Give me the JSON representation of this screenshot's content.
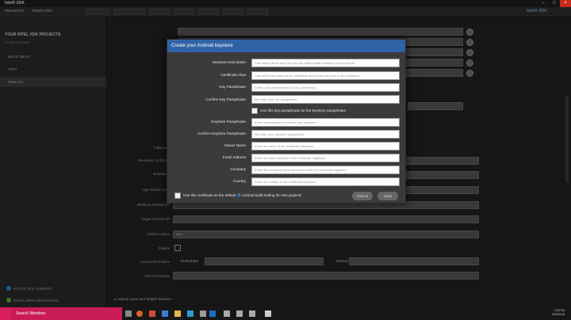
{
  "window": {
    "title": "Intel® XDK"
  },
  "navbar": {
    "tabs": [
      "PROJECTS",
      "TEMPLATES"
    ],
    "brand": "Intel® XDK"
  },
  "sidebar": {
    "heading": "YOUR INTEL XDK PROJECTS",
    "sub": "CLOSE   MANAGE",
    "items": [
      "BUILD IDEAS",
      "TEST",
      "PUBLISH"
    ],
    "bottom_items": [
      "INTEL® XDK SAMPLES",
      "DEVELOPER RESOURCES"
    ]
  },
  "main": {
    "launch_label": "Launch Icons and Splash Screens",
    "form_labels": [
      "Fullscreen",
      "Developer Certificate",
      "Orientation",
      "App Version Code",
      "Minimum Android API",
      "Target Android API",
      "Install Location",
      "Plugins",
      "Crosswalk Runtime",
      "Add Permissions"
    ],
    "install_location_value": "auto",
    "crosswalk_options": [
      "Embedded",
      "Shared"
    ]
  },
  "dialog": {
    "title": "Create your Android keystore",
    "fields": [
      {
        "label": "Keystore Description",
        "placeholder": "This name will be used to help you differentiate between your keystores"
      },
      {
        "label": "Certificate Alias",
        "placeholder": "This will be the name of the certificate and private key pair in your keystore"
      },
      {
        "label": "Key Passphrase",
        "placeholder": "Enter a key passphrase for your private key"
      },
      {
        "label": "Confirm Key Passphrase",
        "placeholder": "Re-enter your key passphrase"
      }
    ],
    "use_key_checkbox_label": "Use this key passphrase for the keystore passphrase",
    "fields2": [
      {
        "label": "Keystore Passphrase",
        "placeholder": "Enter a passphrase to protect your keystore"
      },
      {
        "label": "Confirm Keystore Passphrase",
        "placeholder": "Re-enter your keystore passphrase"
      },
      {
        "label": "Owner Name",
        "placeholder": "Enter the name of the certificate registrant"
      },
      {
        "label": "Email Address",
        "placeholder": "Enter the email address of the certificate registrant"
      },
      {
        "label": "Company",
        "placeholder": "Enter the company name associated with the certificate registrant"
      },
      {
        "label": "Country",
        "placeholder": "Enter the country of the certificate registrant"
      }
    ],
    "default_checkbox_label_a": "Use this certificate as the default",
    "default_checkbox_label_b": "Android build setting for new projects",
    "cancel_label": "Cancel",
    "save_label": "Save"
  },
  "taskbar": {
    "search_placeholder": "Search Windows",
    "time": "4:43 PM",
    "date": "6/12/2016"
  },
  "colors": {
    "dialog_title_bg": "#2f63a6",
    "search_bg": "#c91c54",
    "close_bg": "#c42b1c"
  }
}
